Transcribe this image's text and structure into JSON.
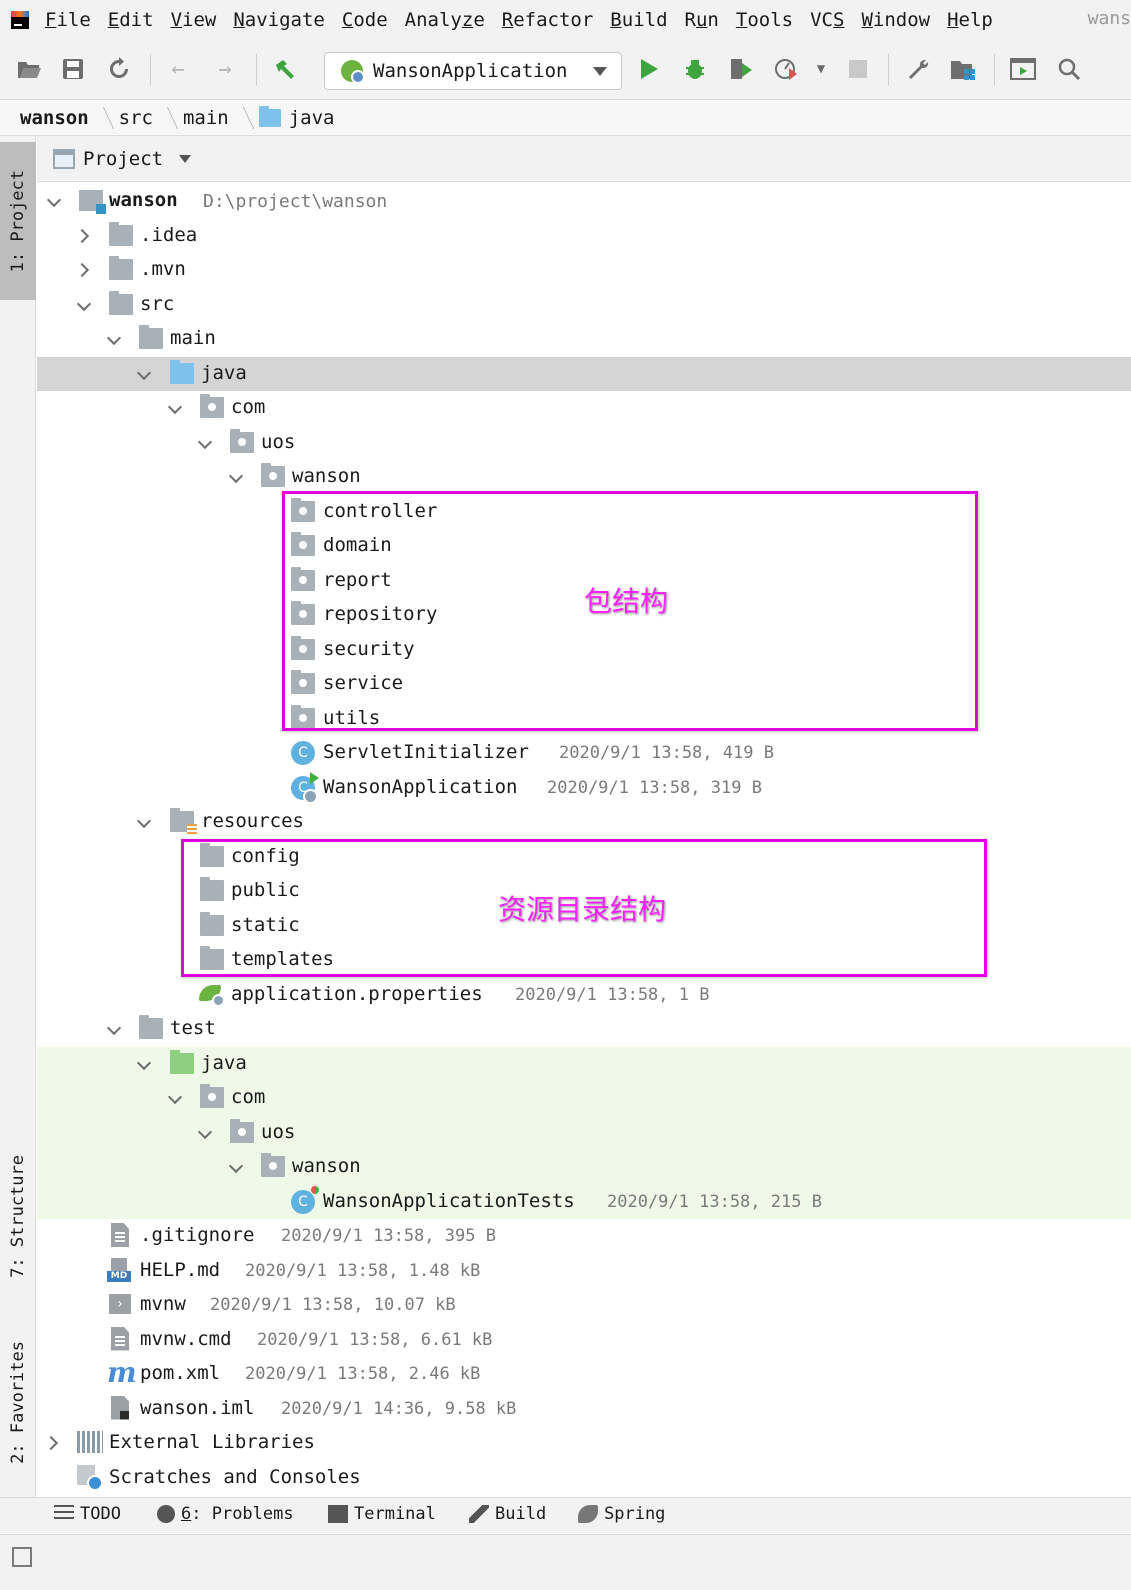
{
  "menu": {
    "items": [
      {
        "u": "F",
        "rest": "ile"
      },
      {
        "u": "E",
        "rest": "dit"
      },
      {
        "u": "V",
        "rest": "iew"
      },
      {
        "u": "N",
        "rest": "avigate"
      },
      {
        "u": "C",
        "rest": "ode"
      },
      {
        "u": "",
        "rest": "Analyze",
        "underline_index": 5
      },
      {
        "u": "R",
        "rest": "efactor"
      },
      {
        "u": "B",
        "rest": "uild"
      },
      {
        "u": "R",
        "rest": "un",
        "underline_index": 1
      },
      {
        "u": "T",
        "rest": "ools"
      },
      {
        "u": "",
        "rest": "VCS",
        "underline_index": 1
      },
      {
        "u": "W",
        "rest": "indow"
      },
      {
        "u": "H",
        "rest": "elp"
      }
    ],
    "project_fragment": "wans"
  },
  "toolbar": {
    "run_config": "WansonApplication",
    "icons": [
      "open-icon",
      "save-icon",
      "sync-icon",
      "back-icon",
      "forward-icon",
      "build-hammer-icon",
      "run-icon",
      "debug-icon",
      "coverage-icon",
      "profile-icon",
      "stop-icon",
      "settings-icon",
      "project-structure-icon",
      "presentation-icon",
      "search-icon"
    ]
  },
  "breadcrumb": {
    "items": [
      "wanson",
      "src",
      "main",
      "java"
    ]
  },
  "side_tabs": {
    "project": "1: Project",
    "structure": "7: Structure",
    "favorites": "2: Favorites"
  },
  "panel": {
    "title": "Project"
  },
  "tree": {
    "root": {
      "name": "wanson",
      "path": "D:\\project\\wanson"
    },
    "idea": ".idea",
    "mvn": ".mvn",
    "src": "src",
    "main": "main",
    "java": "java",
    "com": "com",
    "uos": "uos",
    "wanson_pkg": "wanson",
    "packages": [
      "controller",
      "domain",
      "report",
      "repository",
      "security",
      "service",
      "utils"
    ],
    "servlet_initializer": {
      "name": "ServletInitializer",
      "meta": "2020/9/1 13:58, 419 B"
    },
    "wanson_application": {
      "name": "WansonApplication",
      "meta": "2020/9/1 13:58, 319 B"
    },
    "resources": "resources",
    "resource_dirs": [
      "config",
      "public",
      "static",
      "templates"
    ],
    "application_properties": {
      "name": "application.properties",
      "meta": "2020/9/1 13:58, 1 B"
    },
    "test": "test",
    "test_java": "java",
    "test_com": "com",
    "test_uos": "uos",
    "test_wanson": "wanson",
    "tests_class": {
      "name": "WansonApplicationTests",
      "meta": "2020/9/1 13:58, 215 B"
    },
    "files": [
      {
        "name": ".gitignore",
        "meta": "2020/9/1 13:58, 395 B"
      },
      {
        "name": "HELP.md",
        "meta": "2020/9/1 13:58, 1.48 kB"
      },
      {
        "name": "mvnw",
        "meta": "2020/9/1 13:58, 10.07 kB"
      },
      {
        "name": "mvnw.cmd",
        "meta": "2020/9/1 13:58, 6.61 kB"
      },
      {
        "name": "pom.xml",
        "meta": "2020/9/1 13:58, 2.46 kB"
      },
      {
        "name": "wanson.iml",
        "meta": "2020/9/1 14:36, 9.58 kB"
      }
    ],
    "external_libraries": "External Libraries",
    "scratches": "Scratches and Consoles"
  },
  "annotations": {
    "package_structure": "包结构",
    "resource_structure": "资源目录结构",
    "color": "#e000e0"
  },
  "bottom_tabs": {
    "todo": "TODO",
    "problems_num": "6",
    "problems": ": Problems",
    "terminal": "Terminal",
    "build": "Build",
    "spring": "Spring"
  },
  "colors": {
    "selected_row": "#d5d5d5",
    "test_bg": "#eff9e8",
    "source_folder": "#7ec1ea",
    "test_folder": "#8fcf82"
  }
}
